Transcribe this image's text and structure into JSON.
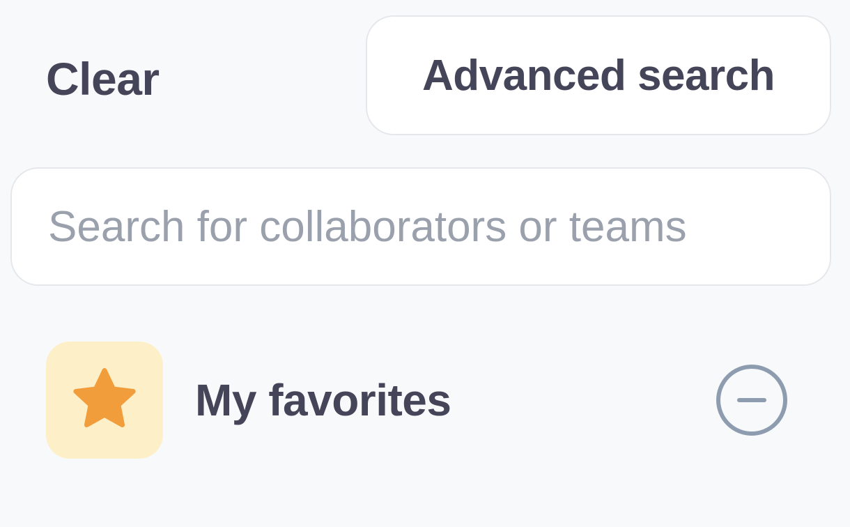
{
  "toolbar": {
    "clear_label": "Clear",
    "advanced_search_label": "Advanced search"
  },
  "search": {
    "placeholder": "Search for collaborators or teams",
    "value": ""
  },
  "favorites": {
    "label": "My favorites",
    "icon": "star-icon",
    "action_icon": "minus-circle-icon"
  },
  "colors": {
    "background": "#f8f9fb",
    "text": "#454559",
    "placeholder": "#9aa1ad",
    "star": "#f29d3b",
    "star_bg": "#fdf0c8",
    "remove_icon": "#8e9cb0"
  }
}
